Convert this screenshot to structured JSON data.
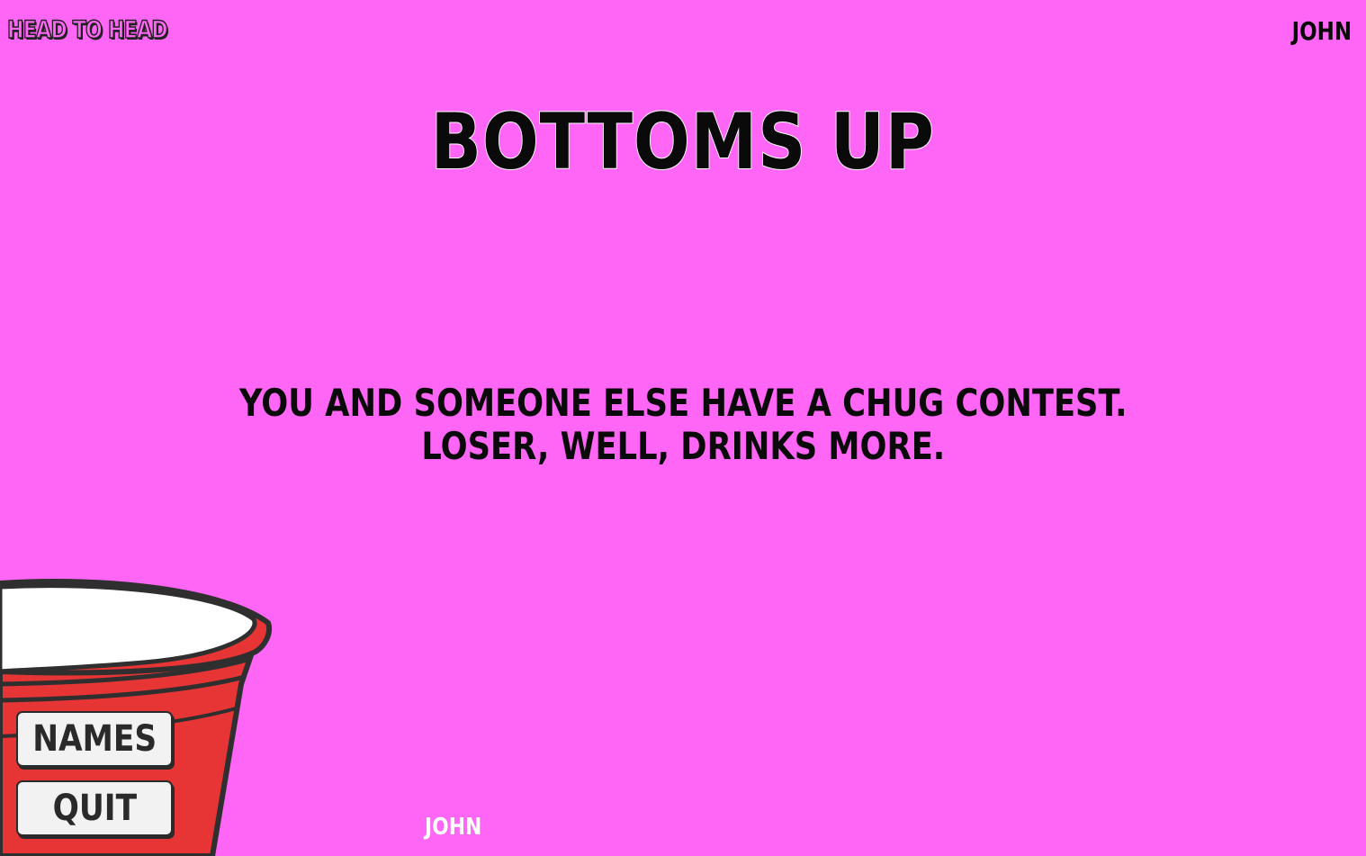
{
  "header": {
    "game_mode": "HEAD TO HEAD",
    "current_player": "JOHN"
  },
  "card": {
    "title": "BOTTOMS UP",
    "body_line_1": "YOU AND SOMEONE ELSE HAVE A CHUG CONTEST.",
    "body_line_2": "LOSER, WELL, DRINKS MORE."
  },
  "footer": {
    "next_player": "JOHN"
  },
  "menu": {
    "names_label": "NAMES",
    "quit_label": "QUIT"
  },
  "colors": {
    "background": "#ff66f5",
    "text": "#0a0a0a",
    "cup_red": "#e73535",
    "button_bg": "#f2f2f2"
  },
  "icons": {
    "cup": "red-party-cup-icon"
  }
}
